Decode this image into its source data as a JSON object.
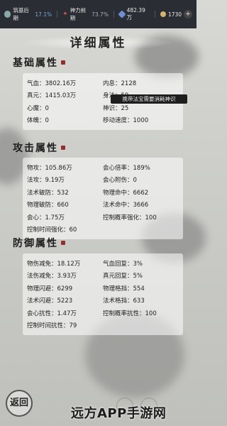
{
  "topbar": {
    "realm": "筑基后期",
    "realm_pct": "17.1%",
    "divine": "神力前期",
    "divine_pct": "73.7%",
    "gems": "482.39万",
    "gold": "1730",
    "plus": "+"
  },
  "title": "详细属性",
  "tooltip": "携带法宝需要消耗神识",
  "sections": [
    {
      "title": "基础属性",
      "rows": [
        [
          "气血：3802.16万",
          "内息：2128"
        ],
        [
          "真元：1415.03万",
          "身法：59"
        ],
        [
          "心魔：0",
          "神识：25"
        ],
        [
          "体魄：0",
          "移动速度：1000"
        ]
      ]
    },
    {
      "title": "攻击属性",
      "rows": [
        [
          "物攻：105.86万",
          "会心倍率：189%"
        ],
        [
          "法攻：9.19万",
          "会心附伤：0"
        ],
        [
          "法术破防：532",
          "物理命中：6662"
        ],
        [
          "物理破防：660",
          "法术命中：3666"
        ],
        [
          "会心：1.75万",
          "控制概率强化：100"
        ],
        [
          "控制时间强化：60",
          ""
        ]
      ]
    },
    {
      "title": "防御属性",
      "rows": [
        [
          "物伤减免：18.12万",
          "气血回复：3%"
        ],
        [
          "法伤减免：3.93万",
          "真元回复：5%"
        ],
        [
          "物理闪避：6299",
          "物理格挡：554"
        ],
        [
          "法术闪避：5223",
          "法术格挡：633"
        ],
        [
          "会心抗性：1.47万",
          "控制概率抗性：100"
        ],
        [
          "控制时间抗性：79",
          ""
        ]
      ]
    }
  ],
  "back_label": "返回",
  "watermark": "远方APP手游网"
}
